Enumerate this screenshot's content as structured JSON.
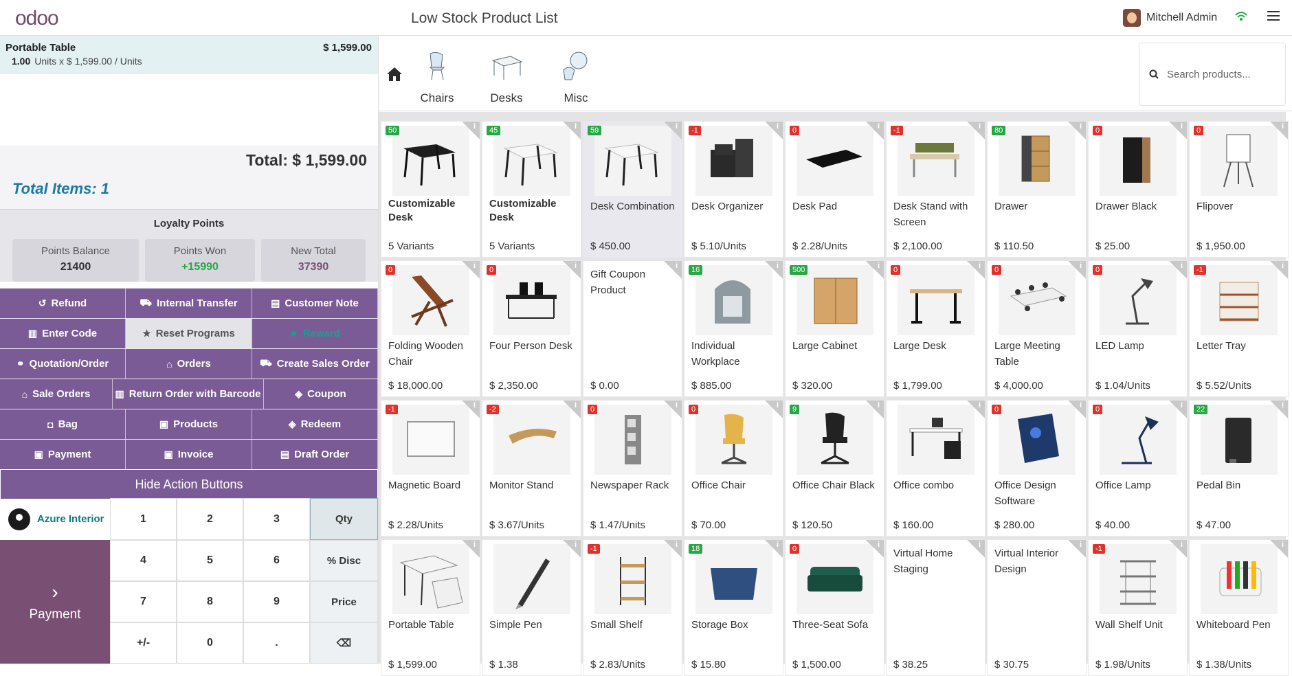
{
  "header": {
    "logo": "odoo",
    "title": "Low Stock Product List",
    "user": "Mitchell Admin"
  },
  "order": {
    "line": {
      "name": "Portable Table",
      "price": "$ 1,599.00",
      "qty": "1.00",
      "detail": "Units x $ 1,599.00 / Units"
    },
    "total": "Total: $ 1,599.00",
    "total_items": "Total Items: 1"
  },
  "loyalty": {
    "title": "Loyalty Points",
    "balance_label": "Points Balance",
    "balance": "21400",
    "won_label": "Points Won",
    "won": "+15990",
    "new_label": "New Total",
    "new_total": "37390"
  },
  "actions": [
    [
      {
        "label": "Refund",
        "icon": "↺"
      },
      {
        "label": "Internal Transfer",
        "icon": "⛟"
      },
      {
        "label": "Customer Note",
        "icon": "▤"
      }
    ],
    [
      {
        "label": "Enter Code",
        "icon": "▥"
      },
      {
        "label": "Reset Programs",
        "icon": "★",
        "style": "light"
      },
      {
        "label": "Reward",
        "icon": "★",
        "style": "green"
      }
    ],
    [
      {
        "label": "Quotation/Order",
        "icon": "⚭"
      },
      {
        "label": "Orders",
        "icon": "⌂"
      },
      {
        "label": "Create Sales Order",
        "icon": "⛟"
      }
    ],
    [
      {
        "label": "Sale Orders",
        "icon": "⌂"
      },
      {
        "label": "Return Order with Barcode",
        "icon": "▥"
      },
      {
        "label": "Coupon",
        "icon": "◈"
      }
    ],
    [
      {
        "label": "Bag",
        "icon": "◘"
      },
      {
        "label": "Products",
        "icon": "▣"
      },
      {
        "label": "Redeem",
        "icon": "◈"
      }
    ],
    [
      {
        "label": "Payment",
        "icon": "▣"
      },
      {
        "label": "Invoice",
        "icon": "▣"
      },
      {
        "label": "Draft Order",
        "icon": "▤"
      }
    ]
  ],
  "hide_actions_label": "Hide Action Buttons",
  "customer": "Azure Interior",
  "payment_label": "Payment",
  "numpad": [
    "1",
    "2",
    "3",
    "Qty",
    "4",
    "5",
    "6",
    "% Disc",
    "7",
    "8",
    "9",
    "Price",
    "+/-",
    "0",
    ".",
    "⌫"
  ],
  "categories": [
    {
      "label": "Chairs"
    },
    {
      "label": "Desks"
    },
    {
      "label": "Misc"
    }
  ],
  "search": {
    "placeholder": "Search products..."
  },
  "products": [
    {
      "name": "Customizable Desk",
      "price": "5 Variants",
      "badge": "50",
      "bc": "g",
      "bold": true,
      "shape": "desk-black"
    },
    {
      "name": "Customizable Desk",
      "price": "5 Variants",
      "badge": "45",
      "bc": "g",
      "bold": true,
      "shape": "desk-white"
    },
    {
      "name": "Desk Combination",
      "price": "$ 450.00",
      "badge": "59",
      "bc": "g",
      "sel": true,
      "shape": "desk-white"
    },
    {
      "name": "Desk Organizer",
      "price": "$ 5.10/Units",
      "badge": "-1",
      "bc": "r",
      "shape": "organizer"
    },
    {
      "name": "Desk Pad",
      "price": "$ 2.28/Units",
      "badge": "0",
      "bc": "r",
      "shape": "pad"
    },
    {
      "name": "Desk Stand with Screen",
      "price": "$ 2,100.00",
      "badge": "-1",
      "bc": "r",
      "shape": "stand"
    },
    {
      "name": "Drawer",
      "price": "$ 110.50",
      "badge": "80",
      "bc": "g",
      "shape": "drawer"
    },
    {
      "name": "Drawer Black",
      "price": "$ 25.00",
      "badge": "0",
      "bc": "r",
      "shape": "drawer-black"
    },
    {
      "name": "Flipover",
      "price": "$ 1,950.00",
      "badge": "0",
      "bc": "r",
      "shape": "flip"
    },
    {
      "name": "Folding Wooden Chair",
      "price": "$ 18,000.00",
      "badge": "0",
      "bc": "r",
      "shape": "chair-wood"
    },
    {
      "name": "Four Person Desk",
      "price": "$ 2,350.00",
      "badge": "0",
      "bc": "r",
      "shape": "desk-four"
    },
    {
      "name": "Gift Coupon Product",
      "price": "$ 0.00",
      "badge": "",
      "nosrc": true
    },
    {
      "name": "Individual Workplace",
      "price": "$ 885.00",
      "badge": "16",
      "bc": "g",
      "shape": "pod"
    },
    {
      "name": "Large Cabinet",
      "price": "$ 320.00",
      "badge": "500",
      "bc": "g",
      "shape": "cabinet"
    },
    {
      "name": "Large Desk",
      "price": "$ 1,799.00",
      "badge": "0",
      "bc": "r",
      "shape": "large-desk"
    },
    {
      "name": "Large Meeting Table",
      "price": "$ 4,000.00",
      "badge": "0",
      "bc": "r",
      "shape": "meeting"
    },
    {
      "name": "LED Lamp",
      "price": "$ 1.04/Units",
      "badge": "0",
      "bc": "r",
      "shape": "lamp"
    },
    {
      "name": "Letter Tray",
      "price": "$ 5.52/Units",
      "badge": "-1",
      "bc": "r",
      "shape": "tray"
    },
    {
      "name": "Magnetic Board",
      "price": "$ 2.28/Units",
      "badge": "-1",
      "bc": "r",
      "shape": "board"
    },
    {
      "name": "Monitor Stand",
      "price": "$ 3.67/Units",
      "badge": "-2",
      "bc": "r",
      "shape": "monitor-stand"
    },
    {
      "name": "Newspaper Rack",
      "price": "$ 1.47/Units",
      "badge": "0",
      "bc": "r",
      "shape": "rack"
    },
    {
      "name": "Office Chair",
      "price": "$ 70.00",
      "badge": "0",
      "bc": "r",
      "shape": "office-chair"
    },
    {
      "name": "Office Chair Black",
      "price": "$ 120.50",
      "badge": "9",
      "bc": "g",
      "shape": "office-chair-black"
    },
    {
      "name": "Office combo",
      "price": "$ 160.00",
      "badge": "",
      "shape": "combo"
    },
    {
      "name": "Office Design Software",
      "price": "$ 280.00",
      "badge": "0",
      "bc": "r",
      "shape": "software"
    },
    {
      "name": "Office Lamp",
      "price": "$ 40.00",
      "badge": "0",
      "bc": "r",
      "shape": "office-lamp"
    },
    {
      "name": "Pedal Bin",
      "price": "$ 47.00",
      "badge": "22",
      "bc": "g",
      "shape": "bin"
    },
    {
      "name": "Portable Table",
      "price": "$ 1,599.00",
      "badge": "",
      "shape": "portable"
    },
    {
      "name": "Simple Pen",
      "price": "$ 1.38",
      "badge": "",
      "shape": "pen"
    },
    {
      "name": "Small Shelf",
      "price": "$ 2.83/Units",
      "badge": "-1",
      "bc": "r",
      "shape": "shelf"
    },
    {
      "name": "Storage Box",
      "price": "$ 15.80",
      "badge": "18",
      "bc": "g",
      "shape": "box"
    },
    {
      "name": "Three-Seat Sofa",
      "price": "$ 1,500.00",
      "badge": "0",
      "bc": "r",
      "shape": "sofa"
    },
    {
      "name": "Virtual Home Staging",
      "price": "$ 38.25",
      "badge": "",
      "nosrc": true
    },
    {
      "name": "Virtual Interior Design",
      "price": "$ 30.75",
      "badge": "",
      "nosrc": true
    },
    {
      "name": "Wall Shelf Unit",
      "price": "$ 1.98/Units",
      "badge": "-1",
      "bc": "r",
      "shape": "wall-shelf"
    },
    {
      "name": "Whiteboard Pen",
      "price": "$ 1.38/Units",
      "badge": "",
      "shape": "markers"
    }
  ]
}
